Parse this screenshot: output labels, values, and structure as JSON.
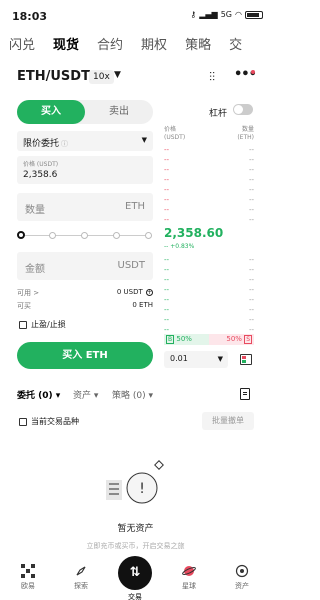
{
  "status_bar": {
    "time": "18:03",
    "network": "5G",
    "battery": ""
  },
  "top_tabs": [
    "闪兑",
    "现货",
    "合约",
    "期权",
    "策略",
    "交"
  ],
  "pair": {
    "name": "ETH/USDT",
    "leverage": "10x"
  },
  "trade": {
    "buy_label": "买入",
    "sell_label": "卖出",
    "margin_label": "杠杆",
    "order_type": "限价委托",
    "price_label": "价格 (USDT)",
    "price_value": "2,358.6",
    "qty_label": "数量",
    "qty_unit": "ETH",
    "amount_label": "金额",
    "amount_unit": "USDT",
    "available_label": "可用 >",
    "available_value": "0 USDT",
    "sellable_label": "可买",
    "sellable_value": "0 ETH",
    "tpsl_label": "止盈/止损",
    "buy_button": "买入 ETH",
    "slider_level": 0
  },
  "orderbook": {
    "price_header": "价格\n(USDT)",
    "qty_header": "数量\n(ETH)",
    "asks": [
      "--",
      "--",
      "--",
      "--",
      "--",
      "--",
      "--",
      "--"
    ],
    "last_price": "2,358.60",
    "last_change": "-- +0.83%",
    "bids": [
      "--",
      "--",
      "--",
      "--",
      "--",
      "--",
      "--",
      "--"
    ],
    "buy_ratio": "50%",
    "sell_ratio": "50%",
    "buy_tag": "B",
    "sell_tag": "S",
    "precision": "0.01"
  },
  "orders": {
    "tabs": [
      "委托 (0)",
      "资产",
      "策略 (0)"
    ],
    "current_pair_label": "当前交易品种",
    "batch_cancel": "批量撤单",
    "empty_title": "暂无资产",
    "empty_sub": "立即充币或买币，开启交易之旅"
  },
  "bottom_nav": [
    "欧易",
    "探索",
    "交易",
    "星球",
    "资产"
  ],
  "colors": {
    "green": "#22b15f",
    "red": "#e84a5f"
  }
}
